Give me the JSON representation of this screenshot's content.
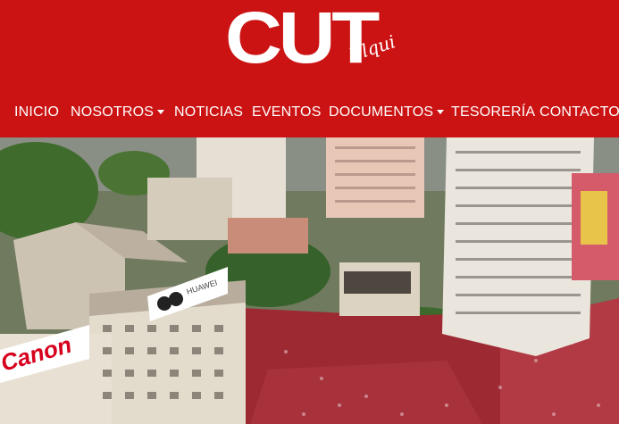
{
  "brand": {
    "name": "CUT",
    "subname": "Elqui"
  },
  "nav": {
    "items": [
      {
        "label": "INICIO",
        "dropdown": false
      },
      {
        "label": "NOSOTROS",
        "dropdown": true
      },
      {
        "label": "NOTICIAS",
        "dropdown": false
      },
      {
        "label": "EVENTOS",
        "dropdown": false
      },
      {
        "label": "DOCUMENTOS",
        "dropdown": true
      },
      {
        "label": "TESORERÍA",
        "dropdown": false
      },
      {
        "label": "CONTACTO",
        "dropdown": false
      }
    ]
  },
  "hero": {
    "signs": [
      "Canon",
      "HUAWEI"
    ]
  },
  "colors": {
    "brand_red": "#cc1313",
    "text": "#ffffff"
  }
}
